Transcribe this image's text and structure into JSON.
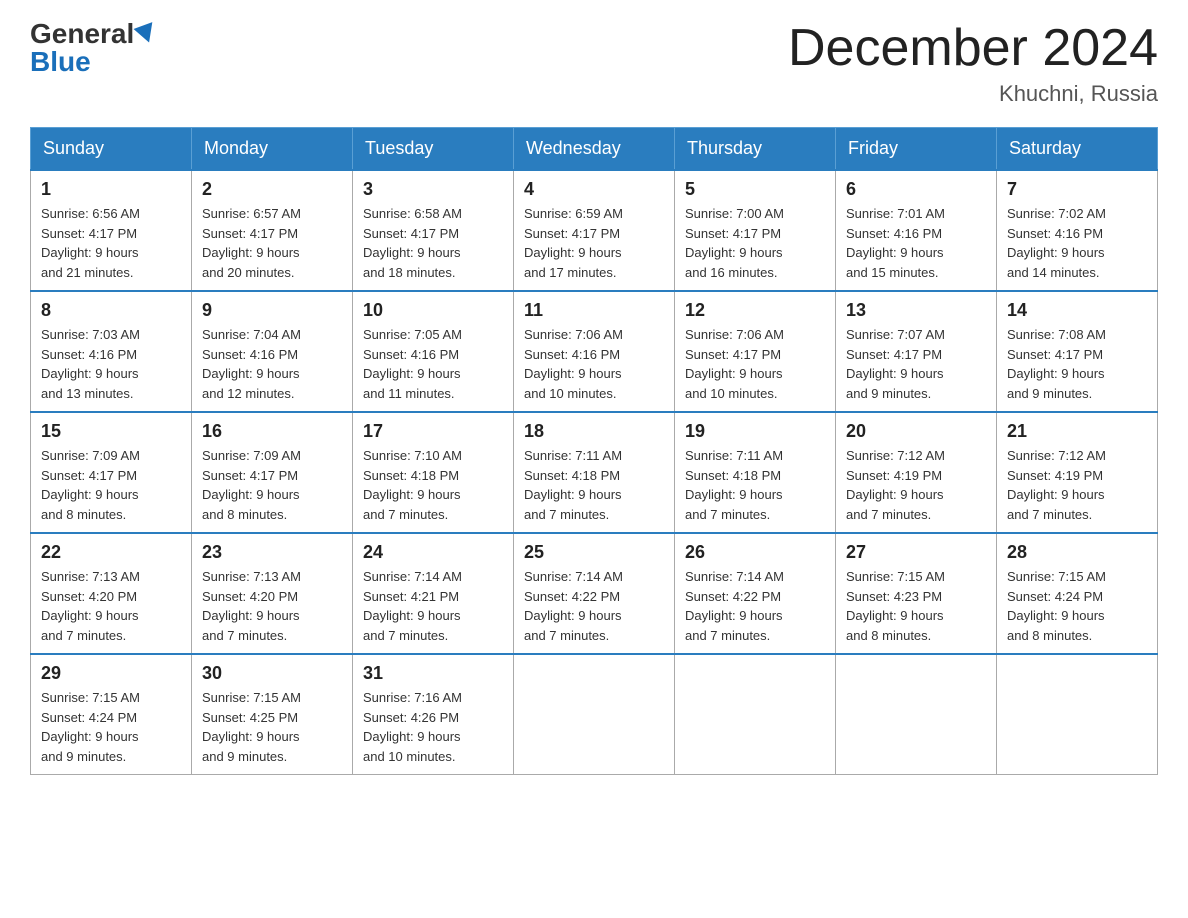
{
  "logo": {
    "general": "General",
    "blue": "Blue"
  },
  "title": "December 2024",
  "location": "Khuchni, Russia",
  "days_header": [
    "Sunday",
    "Monday",
    "Tuesday",
    "Wednesday",
    "Thursday",
    "Friday",
    "Saturday"
  ],
  "weeks": [
    [
      {
        "day": "1",
        "sunrise": "6:56 AM",
        "sunset": "4:17 PM",
        "daylight": "9 hours and 21 minutes."
      },
      {
        "day": "2",
        "sunrise": "6:57 AM",
        "sunset": "4:17 PM",
        "daylight": "9 hours and 20 minutes."
      },
      {
        "day": "3",
        "sunrise": "6:58 AM",
        "sunset": "4:17 PM",
        "daylight": "9 hours and 18 minutes."
      },
      {
        "day": "4",
        "sunrise": "6:59 AM",
        "sunset": "4:17 PM",
        "daylight": "9 hours and 17 minutes."
      },
      {
        "day": "5",
        "sunrise": "7:00 AM",
        "sunset": "4:17 PM",
        "daylight": "9 hours and 16 minutes."
      },
      {
        "day": "6",
        "sunrise": "7:01 AM",
        "sunset": "4:16 PM",
        "daylight": "9 hours and 15 minutes."
      },
      {
        "day": "7",
        "sunrise": "7:02 AM",
        "sunset": "4:16 PM",
        "daylight": "9 hours and 14 minutes."
      }
    ],
    [
      {
        "day": "8",
        "sunrise": "7:03 AM",
        "sunset": "4:16 PM",
        "daylight": "9 hours and 13 minutes."
      },
      {
        "day": "9",
        "sunrise": "7:04 AM",
        "sunset": "4:16 PM",
        "daylight": "9 hours and 12 minutes."
      },
      {
        "day": "10",
        "sunrise": "7:05 AM",
        "sunset": "4:16 PM",
        "daylight": "9 hours and 11 minutes."
      },
      {
        "day": "11",
        "sunrise": "7:06 AM",
        "sunset": "4:16 PM",
        "daylight": "9 hours and 10 minutes."
      },
      {
        "day": "12",
        "sunrise": "7:06 AM",
        "sunset": "4:17 PM",
        "daylight": "9 hours and 10 minutes."
      },
      {
        "day": "13",
        "sunrise": "7:07 AM",
        "sunset": "4:17 PM",
        "daylight": "9 hours and 9 minutes."
      },
      {
        "day": "14",
        "sunrise": "7:08 AM",
        "sunset": "4:17 PM",
        "daylight": "9 hours and 9 minutes."
      }
    ],
    [
      {
        "day": "15",
        "sunrise": "7:09 AM",
        "sunset": "4:17 PM",
        "daylight": "9 hours and 8 minutes."
      },
      {
        "day": "16",
        "sunrise": "7:09 AM",
        "sunset": "4:17 PM",
        "daylight": "9 hours and 8 minutes."
      },
      {
        "day": "17",
        "sunrise": "7:10 AM",
        "sunset": "4:18 PM",
        "daylight": "9 hours and 7 minutes."
      },
      {
        "day": "18",
        "sunrise": "7:11 AM",
        "sunset": "4:18 PM",
        "daylight": "9 hours and 7 minutes."
      },
      {
        "day": "19",
        "sunrise": "7:11 AM",
        "sunset": "4:18 PM",
        "daylight": "9 hours and 7 minutes."
      },
      {
        "day": "20",
        "sunrise": "7:12 AM",
        "sunset": "4:19 PM",
        "daylight": "9 hours and 7 minutes."
      },
      {
        "day": "21",
        "sunrise": "7:12 AM",
        "sunset": "4:19 PM",
        "daylight": "9 hours and 7 minutes."
      }
    ],
    [
      {
        "day": "22",
        "sunrise": "7:13 AM",
        "sunset": "4:20 PM",
        "daylight": "9 hours and 7 minutes."
      },
      {
        "day": "23",
        "sunrise": "7:13 AM",
        "sunset": "4:20 PM",
        "daylight": "9 hours and 7 minutes."
      },
      {
        "day": "24",
        "sunrise": "7:14 AM",
        "sunset": "4:21 PM",
        "daylight": "9 hours and 7 minutes."
      },
      {
        "day": "25",
        "sunrise": "7:14 AM",
        "sunset": "4:22 PM",
        "daylight": "9 hours and 7 minutes."
      },
      {
        "day": "26",
        "sunrise": "7:14 AM",
        "sunset": "4:22 PM",
        "daylight": "9 hours and 7 minutes."
      },
      {
        "day": "27",
        "sunrise": "7:15 AM",
        "sunset": "4:23 PM",
        "daylight": "9 hours and 8 minutes."
      },
      {
        "day": "28",
        "sunrise": "7:15 AM",
        "sunset": "4:24 PM",
        "daylight": "9 hours and 8 minutes."
      }
    ],
    [
      {
        "day": "29",
        "sunrise": "7:15 AM",
        "sunset": "4:24 PM",
        "daylight": "9 hours and 9 minutes."
      },
      {
        "day": "30",
        "sunrise": "7:15 AM",
        "sunset": "4:25 PM",
        "daylight": "9 hours and 9 minutes."
      },
      {
        "day": "31",
        "sunrise": "7:16 AM",
        "sunset": "4:26 PM",
        "daylight": "9 hours and 10 minutes."
      },
      null,
      null,
      null,
      null
    ]
  ],
  "labels": {
    "sunrise": "Sunrise:",
    "sunset": "Sunset:",
    "daylight": "Daylight:"
  }
}
